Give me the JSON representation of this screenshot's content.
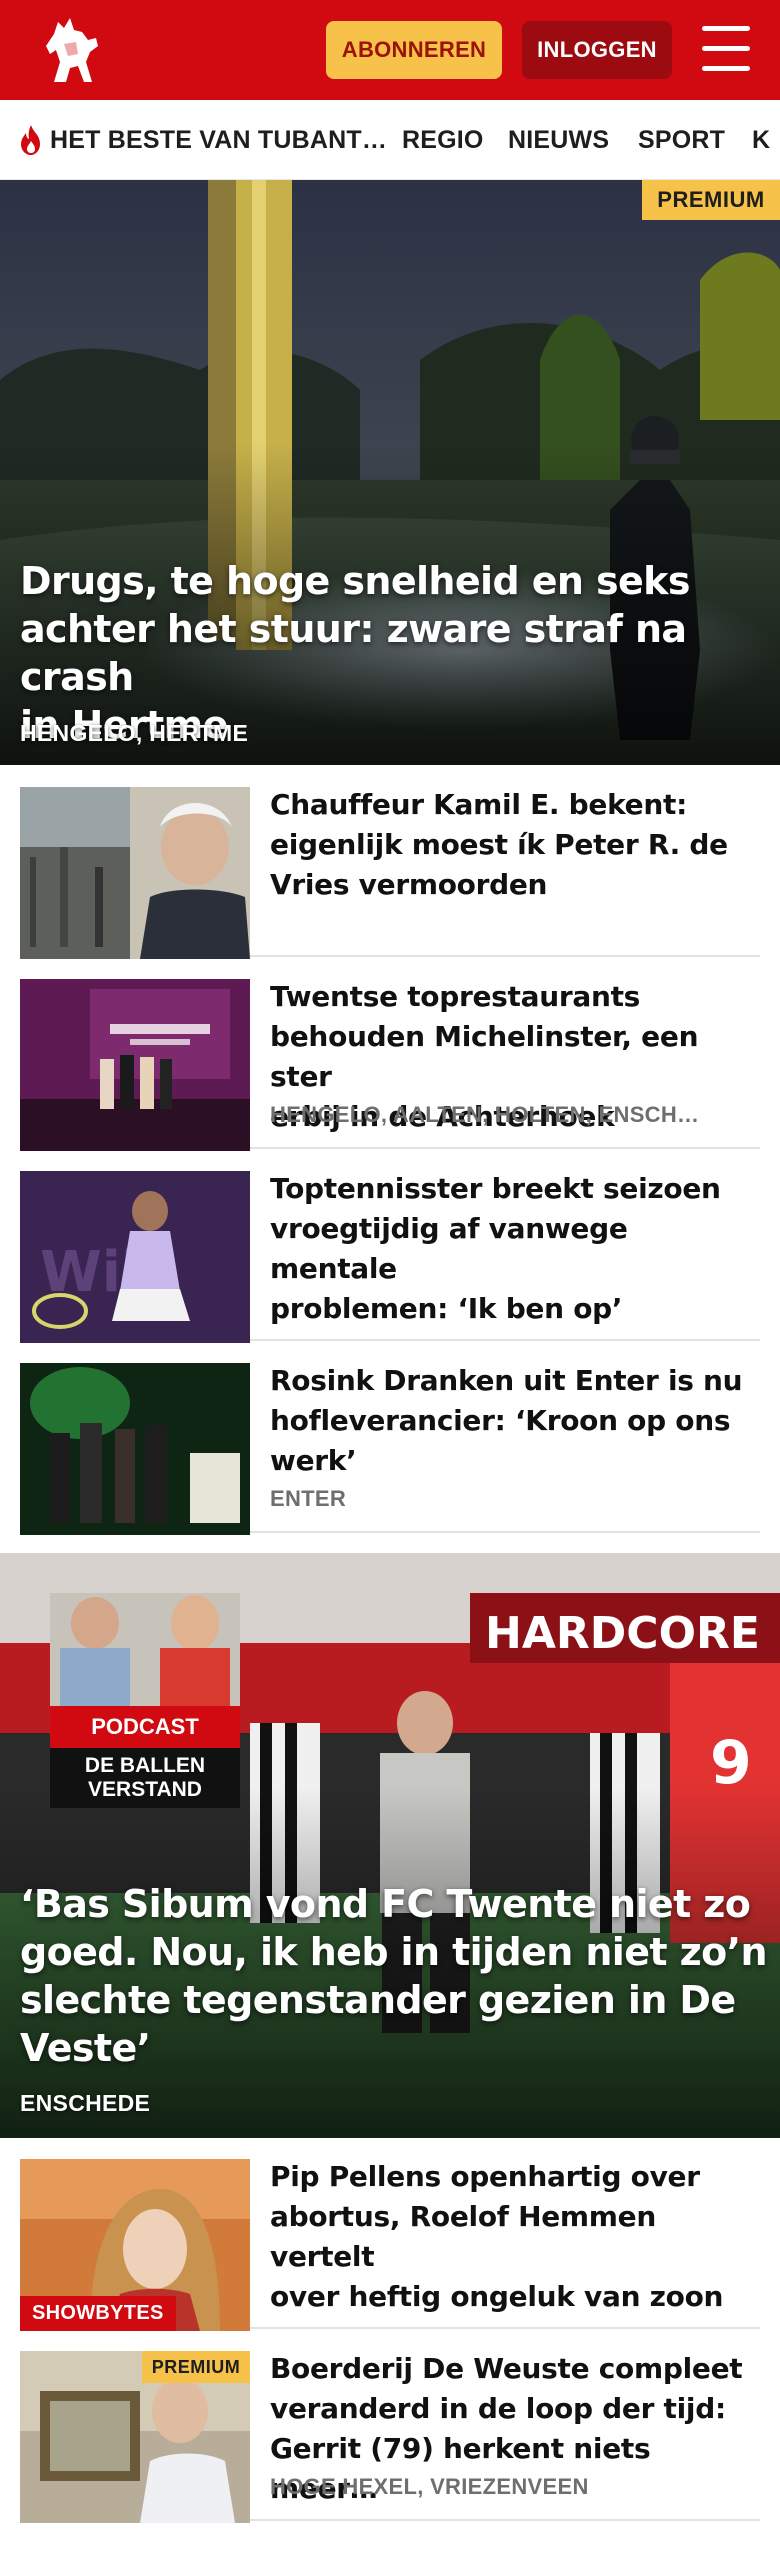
{
  "header": {
    "subscribe_label": "ABONNEREN",
    "login_label": "INLOGGEN",
    "brand_color": "#d10a11",
    "subscribe_bg": "#f6c24a"
  },
  "nav": {
    "items": [
      "HET BESTE VAN TUBANT…",
      "REGIO",
      "NIEUWS",
      "SPORT",
      "K"
    ]
  },
  "hero": {
    "badge": "PREMIUM",
    "title_lines": [
      "Drugs, te hoge snelheid en seks",
      "achter het stuur: zware straf na crash",
      "in Hertme"
    ],
    "location": "HENGELO, HERTME"
  },
  "articles": [
    {
      "title_lines": [
        "Chauffeur Kamil E. bekent:",
        "eigenlijk moest ík Peter R. de",
        "Vries vermoorden"
      ],
      "location": ""
    },
    {
      "title_lines": [
        "Twentse toprestaurants",
        "behouden Michelinster, een ster",
        "erbij in de Achterhoek"
      ],
      "location": "HENGELO, AALTEN, HOLTEN, ENSCH…"
    },
    {
      "title_lines": [
        "Toptennisster breekt seizoen",
        "vroegtijdig af vanwege mentale",
        "problemen: ‘Ik ben op’"
      ],
      "location": ""
    },
    {
      "title_lines": [
        "Rosink Dranken uit Enter is nu",
        "hofleverancier: ‘Kroon op ons",
        "werk’"
      ],
      "location": "ENTER"
    }
  ],
  "feature": {
    "podcast_label": "PODCAST",
    "podcast_name_lines": [
      "DE BALLEN",
      "VERSTAND"
    ],
    "title_lines": [
      "‘Bas Sibum vond FC Twente niet zo",
      "goed. Nou, ik heb in tijden niet zo’n",
      "slechte tegenstander gezien in De",
      "Veste’"
    ],
    "location": "ENSCHEDE"
  },
  "bottom_articles": [
    {
      "label": "SHOWBYTES",
      "title_lines": [
        "Pip Pellens openhartig over",
        "abortus, Roelof Hemmen vertelt",
        "over heftig ongeluk van zoon"
      ],
      "location": ""
    },
    {
      "badge": "PREMIUM",
      "title_lines": [
        "Boerderij De Weuste compleet",
        "veranderd in de loop der tijd:",
        "Gerrit (79) herkent niets meer…"
      ],
      "location": "HOGE HEXEL, VRIEZENVEEN"
    }
  ]
}
